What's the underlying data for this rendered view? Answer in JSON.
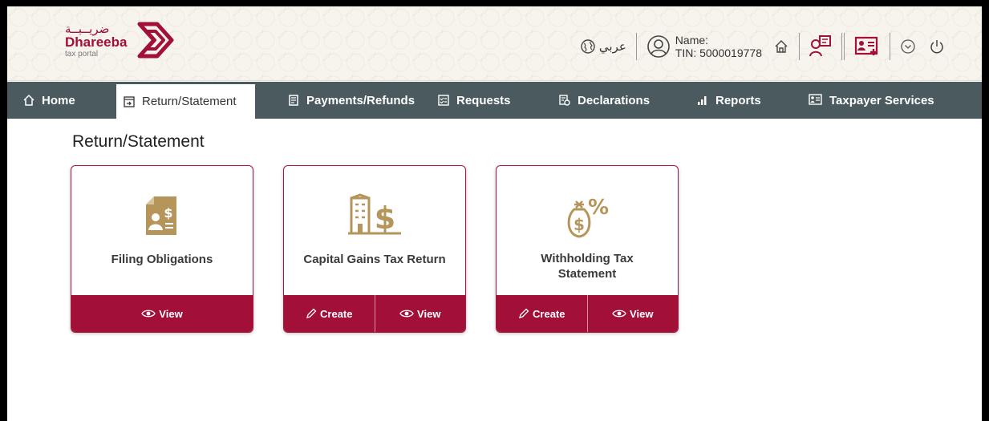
{
  "header": {
    "logo_ar": "ضريــبــة",
    "logo_en": "Dhareeba",
    "logo_sub": "tax portal",
    "language_label": "عربي",
    "user_name_label": "Name:",
    "user_tin": "TIN: 5000019778",
    "icons": [
      "globe-icon",
      "user-circle-icon",
      "home-icon",
      "people-icon",
      "id-card-icon",
      "chevron-down-icon",
      "power-icon"
    ]
  },
  "nav": {
    "items": [
      {
        "label": "Home",
        "icon": "home-icon"
      },
      {
        "label": "Return/Statement",
        "icon": "return-icon",
        "active": true
      },
      {
        "label": "Payments/Refunds",
        "icon": "payments-icon"
      },
      {
        "label": "Requests",
        "icon": "requests-icon"
      },
      {
        "label": "Declarations",
        "icon": "declarations-icon"
      },
      {
        "label": "Reports",
        "icon": "reports-icon"
      },
      {
        "label": "Taxpayer Services",
        "icon": "taxpayer-services-icon"
      }
    ]
  },
  "page": {
    "title": "Return/Statement"
  },
  "cards": [
    {
      "title": "Filing Obligations",
      "icon": "filing-icon",
      "actions": [
        "View"
      ]
    },
    {
      "title": "Capital Gains Tax Return",
      "icon": "capital-gains-icon",
      "actions": [
        "Create",
        "View"
      ]
    },
    {
      "title_line1": "Withholding Tax",
      "title_line2": "Statement",
      "icon": "money-bag-percent-icon",
      "actions": [
        "Create",
        "View"
      ]
    }
  ],
  "colors": {
    "brand": "#a20f37",
    "nav_bg": "#4a5a5e",
    "icon_gold": "#b5955a",
    "header_bg": "#f7f4ee"
  }
}
